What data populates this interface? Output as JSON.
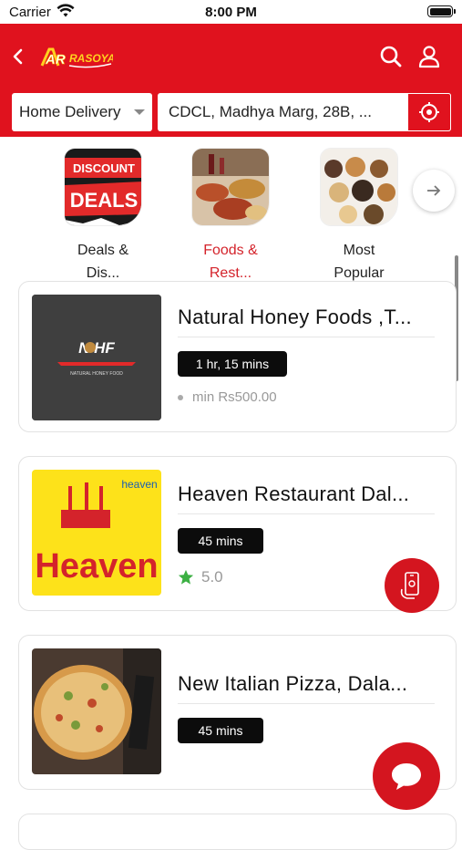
{
  "status_bar": {
    "carrier": "Carrier",
    "time": "8:00 PM"
  },
  "header": {
    "logo_text": "AR RASOYA",
    "delivery_mode": "Home Delivery",
    "address": "CDCL, Madhya Marg, 28B, ..."
  },
  "categories": [
    {
      "label": "Deals &\nDis...",
      "thumb_text_top": "DISCOUNT",
      "thumb_text_bottom": "DEALS",
      "active": false
    },
    {
      "label": "Foods &\nRest...",
      "active": true
    },
    {
      "label": "Most\nPopular",
      "active": false
    }
  ],
  "restaurants": [
    {
      "name": "Natural Honey Foods ,T...",
      "time": "1 hr, 15 mins",
      "min_order": "min Rs500.00",
      "logo_text": "N HF",
      "logo_subtext": "NATURAL HONEY FOOD"
    },
    {
      "name": "Heaven Restaurant Dal...",
      "time": "45 mins",
      "rating": "5.0",
      "logo_text": "Heaven",
      "logo_tag": "heaven"
    },
    {
      "name": "New Italian Pizza, Dala...",
      "time": "45 mins"
    }
  ],
  "colors": {
    "brand_red": "#e0121e",
    "active_category": "#d4232b",
    "star": "#3cb043"
  }
}
